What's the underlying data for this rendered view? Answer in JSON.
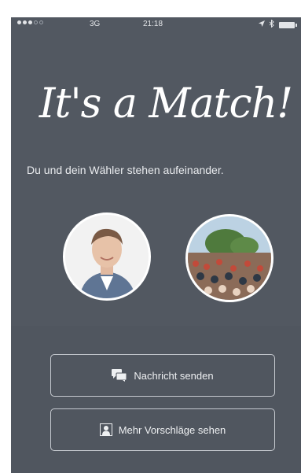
{
  "status_bar": {
    "carrier": "3G",
    "time": "21:18"
  },
  "match": {
    "title": "It's a Match!",
    "subtitle": "Du und dein Wähler stehen aufeinander."
  },
  "actions": {
    "send_message": "Nachricht senden",
    "more_suggestions": "Mehr Vorschläge sehen"
  },
  "icons": {
    "send_message": "chat-bubbles-icon",
    "more_suggestions": "person-card-icon"
  },
  "colors": {
    "background": "#525861",
    "text": "#ffffff",
    "button_border": "#c6cad0"
  }
}
